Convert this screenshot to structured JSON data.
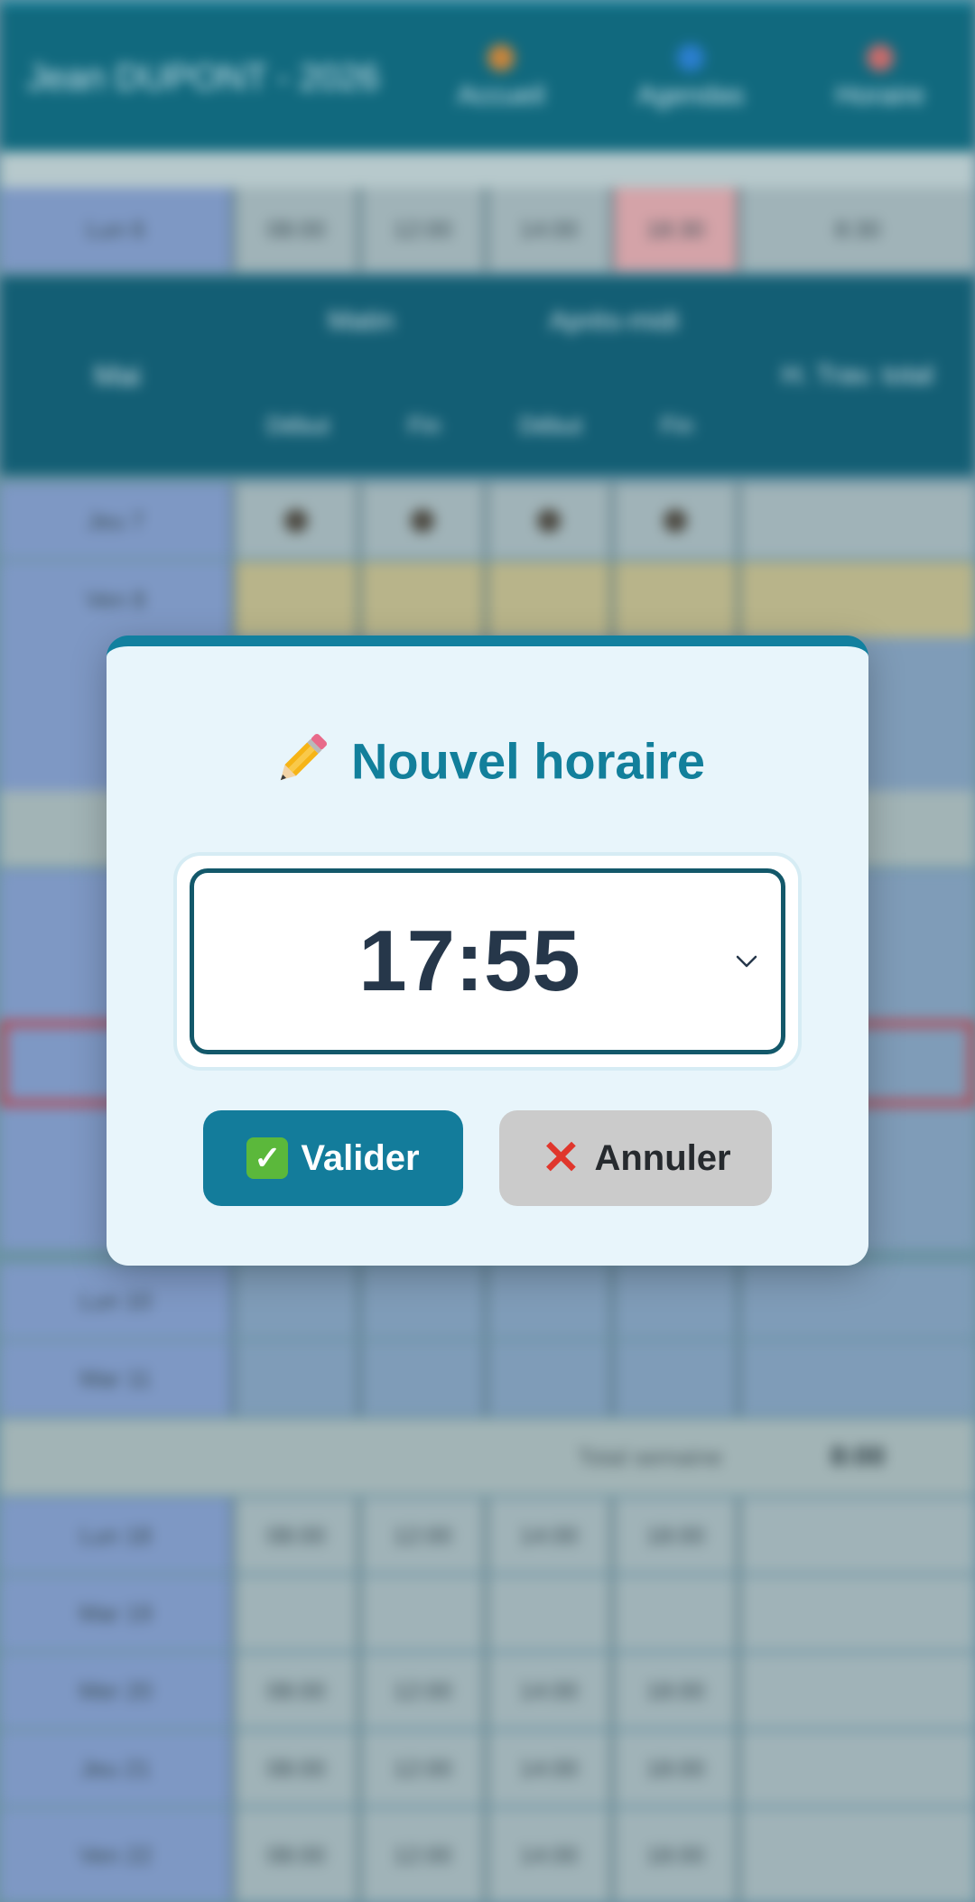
{
  "background": {
    "header": {
      "user": "Jean DUPONT - 2026",
      "nav": [
        {
          "label": "Accueil",
          "icon": "home-icon"
        },
        {
          "label": "Agendas",
          "icon": "calendar-icon"
        },
        {
          "label": "Horaire",
          "icon": "clock-icon"
        }
      ]
    },
    "first_row": {
      "day": "Lun 6",
      "times": [
        "08:00",
        "12:00",
        "14:00",
        "18:30"
      ],
      "total": "8:30"
    },
    "table_header": {
      "col0": "Mai",
      "group1": "Matin",
      "group2": "Après-midi",
      "sub": [
        "Début",
        "Fin",
        "Début",
        "Fin"
      ],
      "col5": "H. Trav. total"
    },
    "rows": [
      {
        "day": "Jeu 7",
        "style": "dots"
      },
      {
        "day": "Ven 8",
        "style": "yellow"
      },
      {
        "day": "Lun 10",
        "style": "blue"
      },
      {
        "day": "Mar 11",
        "style": "blue"
      }
    ],
    "total_label": "Total semaine",
    "total_value": "8:00",
    "lower_rows": [
      {
        "day": "Lun 18",
        "times": [
          "08:00",
          "12:00",
          "14:00",
          "18:00"
        ]
      },
      {
        "day": "Mar 19",
        "times": [
          "",
          "",
          "",
          ""
        ]
      },
      {
        "day": "Mer 20",
        "times": [
          "08:00",
          "12:00",
          "14:00",
          "18:00"
        ]
      },
      {
        "day": "Jeu 21",
        "times": [
          "08:00",
          "12:00",
          "14:00",
          "18:00"
        ]
      },
      {
        "day": "Ven 22",
        "times": [
          "08:00",
          "12:00",
          "14:00",
          "18:00"
        ]
      }
    ]
  },
  "modal": {
    "title": "Nouvel horaire",
    "title_icon": "pencil-icon",
    "time_value": "17:55",
    "validate_label": "Valider",
    "cancel_label": "Annuler",
    "colors": {
      "accent": "#127f9b",
      "button_primary": "#137c9b",
      "button_secondary": "#cbcbcb"
    }
  }
}
